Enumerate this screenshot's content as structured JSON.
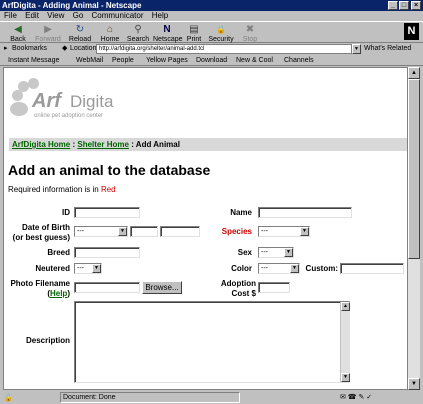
{
  "window": {
    "title": "ArfDigita - Adding Animal - Netscape"
  },
  "menu": [
    "File",
    "Edit",
    "View",
    "Go",
    "Communicator",
    "Help"
  ],
  "toolbar": [
    {
      "label": "Back",
      "icon": "back-arrow-icon",
      "glyph": "◀"
    },
    {
      "label": "Forward",
      "icon": "forward-arrow-icon",
      "glyph": "▶"
    },
    {
      "label": "Reload",
      "icon": "reload-icon",
      "glyph": "↻"
    },
    {
      "label": "Home",
      "icon": "home-icon",
      "glyph": "⌂"
    },
    {
      "label": "Search",
      "icon": "search-icon",
      "glyph": "⚲"
    },
    {
      "label": "Netscape",
      "icon": "netscape-icon",
      "glyph": "N"
    },
    {
      "label": "Print",
      "icon": "print-icon",
      "glyph": "▤"
    },
    {
      "label": "Security",
      "icon": "security-lock-icon",
      "glyph": "🔒"
    },
    {
      "label": "Stop",
      "icon": "stop-icon",
      "glyph": "✖"
    }
  ],
  "location": {
    "bookmarks_label": "Bookmarks",
    "location_label": "Location:",
    "url": "http://arfdigita.org/shelter/animal-add.tcl",
    "whats_related": "What's Related"
  },
  "personal_toolbar": [
    "Instant Message",
    "WebMail",
    "People",
    "Yellow Pages",
    "Download",
    "New & Cool",
    "Channels"
  ],
  "logo": {
    "main_a": "Arf",
    "main_b": "Digita",
    "tagline": "online pet adoption center"
  },
  "breadcrumb": {
    "home": "ArfDigita Home",
    "sep": ":",
    "shelter": "Shelter Home",
    "current": "Add Animal"
  },
  "page": {
    "heading": "Add an animal to the database",
    "required_prefix": "Required information is in ",
    "required_color_word": "Red"
  },
  "form": {
    "id_label": "ID",
    "name_label": "Name",
    "dob_label_1": "Date of Birth",
    "dob_label_2": "(or best guess)",
    "dob_month": "---",
    "species_label": "Species",
    "species_value": "---",
    "breed_label": "Breed",
    "sex_label": "Sex",
    "sex_value": "---",
    "neutered_label": "Neutered",
    "neutered_value": "---",
    "color_label": "Color",
    "color_value": "---",
    "custom_label": "Custom:",
    "photo_label": "Photo Filename",
    "help_open": "(",
    "help_link": "Help",
    "help_close": ")",
    "browse_button": "Browse...",
    "adoption_label_1": "Adoption",
    "adoption_label_2": "Cost $",
    "description_label": "Description"
  },
  "status": {
    "text": "Document: Done"
  },
  "colors": {
    "titlebar": "#0a246a",
    "required": "#cc0000",
    "link": "#006600"
  }
}
